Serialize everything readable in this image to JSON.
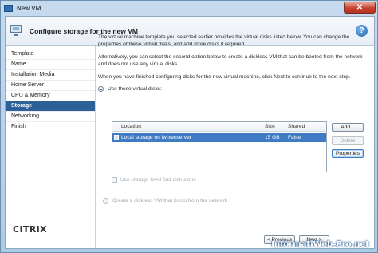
{
  "window": {
    "title": "New VM",
    "close_label": "✕"
  },
  "header": {
    "title": "Configure storage for the new VM",
    "help_label": "?"
  },
  "sidebar": {
    "items": [
      {
        "label": "Template",
        "active": false
      },
      {
        "label": "Name",
        "active": false
      },
      {
        "label": "Installation Media",
        "active": false
      },
      {
        "label": "Home Server",
        "active": false
      },
      {
        "label": "CPU & Memory",
        "active": false
      },
      {
        "label": "Storage",
        "active": true
      },
      {
        "label": "Networking",
        "active": false
      },
      {
        "label": "Finish",
        "active": false
      }
    ],
    "logo": "CiTRiX"
  },
  "content": {
    "para1": "The virtual machine template you selected earlier provides the virtual disks listed below. You can change the properties of these virtual disks, and add more disks if required.",
    "para2": "Alternatively, you can select the second option below to create a diskless VM that can be booted from the network and does not use any virtual disks.",
    "para3": "When you have finished configuring disks for the new virtual machine, click Next to continue to the next step.",
    "use_disks_label": "Use these virtual disks:",
    "table": {
      "headers": {
        "location": "Location",
        "size": "Size",
        "shared": "Shared"
      },
      "rows": [
        {
          "location": "Local storage on iw-xenserver",
          "size": "15 GB",
          "shared": "False"
        }
      ]
    },
    "buttons": {
      "add": "Add...",
      "delete": "Delete",
      "properties": "Properties"
    },
    "fast_clone_label": "Use storage-level fast disk clone",
    "diskless_label": "Create a diskless VM that boots from the network"
  },
  "footer": {
    "previous": "< Previous",
    "next": "Next >"
  },
  "watermark": "InformatiWeb-Pro.net",
  "colors": {
    "accent": "#2d5f99",
    "selection": "#3e7bc4"
  }
}
